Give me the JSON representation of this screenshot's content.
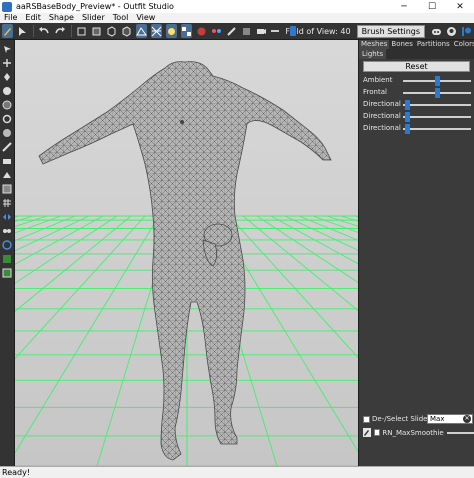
{
  "window": {
    "title": "aaRSBaseBody_Preview* - Outfit Studio",
    "minimize_glyph": "─",
    "maximize_glyph": "☐",
    "close_glyph": "✕"
  },
  "menu": {
    "items": [
      "File",
      "Edit",
      "Shape",
      "Slider",
      "Tool",
      "View"
    ]
  },
  "toolbar": {
    "field_of_view_label": "Field of View: 40",
    "brush_settings_label": "Brush Settings",
    "fov_value": 0.55
  },
  "right_panel": {
    "tabs": [
      "Meshes",
      "Bones",
      "Partitions",
      "Colors"
    ],
    "subtab": "Lights",
    "reset_label": "Reset",
    "lights": [
      {
        "label": "Ambient",
        "value": 0.5
      },
      {
        "label": "Frontal",
        "value": 0.5
      },
      {
        "label": "Directional",
        "value": 0.03
      },
      {
        "label": "Directional",
        "value": 0.03
      },
      {
        "label": "Directional",
        "value": 0.03
      }
    ],
    "sliders_header": {
      "deselect_label": "De-/Select Sliders",
      "search_value": "Max",
      "clear_glyph": "✕"
    },
    "slider_items": [
      {
        "name": "RN_MaxSmoothie"
      }
    ]
  },
  "status": {
    "text": "Ready!"
  },
  "colors": {
    "accent": "#2c79d0",
    "grid": "#3cf06a",
    "mesh_fill": "#b4b4b4",
    "mesh_line": "#5a5a5a"
  },
  "icons": {
    "left_tools": [
      "select-icon",
      "transform-icon",
      "pin-icon",
      "brush-inflate-icon",
      "brush-deflate-icon",
      "brush-move-icon",
      "brush-smooth-icon",
      "brush-undiff-icon",
      "weight-brush-icon",
      "color-brush-icon",
      "mask-icon",
      "grid-icon",
      "xmirror-icon",
      "connected-only-icon",
      "global-brush-icon",
      "brush-collision-icon",
      "restore-icon"
    ]
  }
}
